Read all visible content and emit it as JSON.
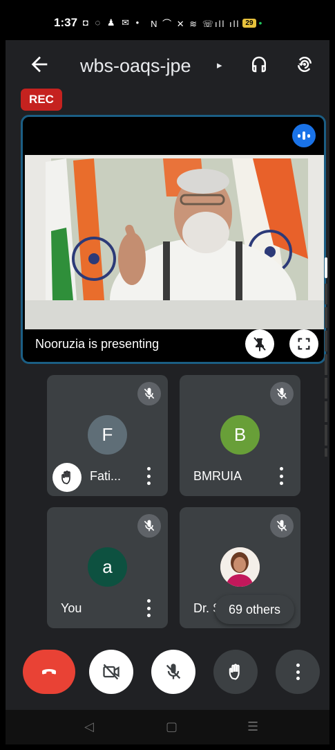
{
  "status_bar": {
    "time": "1:37",
    "left_icons": "◘ ◌ ♟ ✉ •",
    "right_icons": "N ⌒ ✕ ≋ ☏ıll ıll",
    "battery": "29"
  },
  "header": {
    "meeting_code": "wbs-oaqs-jpe",
    "caret": "▸"
  },
  "rec_badge": "REC",
  "presentation": {
    "caption": "Nooruzia is presenting"
  },
  "participants": [
    {
      "initial": "F",
      "name": "Fati...",
      "avatar_color": "#5f6e77"
    },
    {
      "initial": "B",
      "name": "BMRUIA",
      "avatar_color": "#689f38"
    },
    {
      "initial": "a",
      "name": "You",
      "avatar_color": "#0d5140"
    },
    {
      "initial": "",
      "name": "Dr. S",
      "avatar_color": "#e8b49a"
    }
  ],
  "others_badge": "69 others",
  "colors": {
    "end_call": "#e94235",
    "accent_blue": "#1a73e8",
    "rec_red": "#c5221f"
  }
}
